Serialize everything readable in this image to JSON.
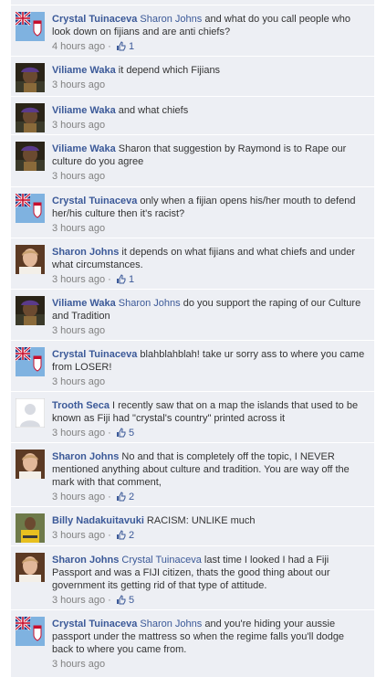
{
  "comments": [
    {
      "author": "Crystal Tuinaceva",
      "avatar": "flag",
      "mention": "Sharon Johns",
      "text": " and what do you call people who look down on fijians and are anti chiefs?",
      "time": "4 hours ago",
      "likes": "1"
    },
    {
      "author": "Viliame Waka",
      "avatar": "portrait-dark",
      "mention": "",
      "text": " it depend which Fijians",
      "time": "3 hours ago",
      "likes": ""
    },
    {
      "author": "Viliame Waka",
      "avatar": "portrait-dark",
      "mention": "",
      "text": " and what chiefs",
      "time": "3 hours ago",
      "likes": ""
    },
    {
      "author": "Viliame Waka",
      "avatar": "portrait-dark",
      "mention": "",
      "text": " Sharon that suggestion by Raymond is to Rape our culture do you agree",
      "time": "3 hours ago",
      "likes": ""
    },
    {
      "author": "Crystal Tuinaceva",
      "avatar": "flag",
      "mention": "",
      "text": " only when a fijian opens his/her mouth to defend her/his culture then it's racist?",
      "time": "3 hours ago",
      "likes": ""
    },
    {
      "author": "Sharon Johns",
      "avatar": "portrait-light",
      "mention": "",
      "text": " it depends on what fijians and what chiefs and under what circumstances.",
      "time": "3 hours ago",
      "likes": "1"
    },
    {
      "author": "Viliame Waka",
      "avatar": "portrait-dark",
      "mention": "Sharon Johns",
      "text": " do you support the raping of our Culture and Tradition",
      "time": "3 hours ago",
      "likes": ""
    },
    {
      "author": "Crystal Tuinaceva",
      "avatar": "flag",
      "mention": "",
      "text": " blahblahblah! take ur sorry ass to where you came from LOSER!",
      "time": "3 hours ago",
      "likes": ""
    },
    {
      "author": "Trooth Seca",
      "avatar": "silhouette",
      "mention": "",
      "text": " I recently saw that on a map the islands that used to be known as Fiji had \"crystal's country\" printed across it",
      "time": "3 hours ago",
      "likes": "5"
    },
    {
      "author": "Sharon Johns",
      "avatar": "portrait-light",
      "mention": "",
      "text": " No and that is completely off the topic, I NEVER mentioned anything about culture and tradition. You are way off the mark with that comment,",
      "time": "3 hours ago",
      "likes": "2"
    },
    {
      "author": "Billy Nadakuitavuki",
      "avatar": "portrait-yellow",
      "mention": "",
      "text": " RACISM: UNLIKE much",
      "time": "3 hours ago",
      "likes": "2"
    },
    {
      "author": "Sharon Johns",
      "avatar": "portrait-light",
      "mention": "Crystal Tuinaceva",
      "text": " last time I looked I had a Fiji Passport and was a FIJI citizen, thats the good thing about our government its getting rid of that type of attitude.",
      "time": "3 hours ago",
      "likes": "5"
    },
    {
      "author": "Crystal Tuinaceva",
      "avatar": "flag",
      "mention": "Sharon Johns",
      "text": " and you're hiding your aussie passport under the mattress so when the regime falls you'll dodge back to where you came from.",
      "time": "3 hours ago",
      "likes": ""
    }
  ],
  "colors": {
    "link": "#3b5998",
    "meta": "#808080",
    "background": "#edeff4"
  }
}
